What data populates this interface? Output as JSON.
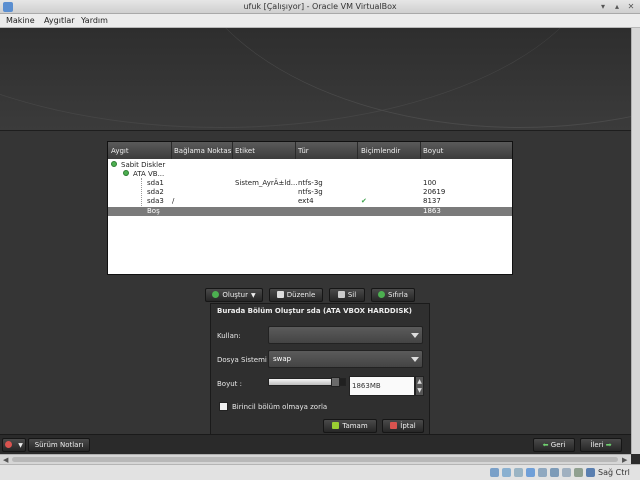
{
  "window": {
    "title": "ufuk [Çalışıyor] - Oracle VM VirtualBox"
  },
  "menu": {
    "items": [
      "Makine",
      "Aygıtlar",
      "Yardım"
    ]
  },
  "partition_table": {
    "columns": [
      "Aygıt",
      "Bağlama Noktası",
      "Etiket",
      "Tür",
      "Biçimlendir",
      "Boyut"
    ],
    "group_label": "Sabit Diskler",
    "disk_label": "ATA VB...",
    "rows": [
      {
        "device": "sda1",
        "mount": "",
        "label": "Sistem_AyrÄ±ld...",
        "type": "ntfs-3g",
        "format": "",
        "size": "100"
      },
      {
        "device": "sda2",
        "mount": "",
        "label": "",
        "type": "ntfs-3g",
        "format": "",
        "size": "20619"
      },
      {
        "device": "sda3",
        "mount": "/",
        "label": "",
        "type": "ext4",
        "format": "✔",
        "size": "8137"
      },
      {
        "device": "Boş",
        "mount": "",
        "label": "",
        "type": "",
        "format": "",
        "size": "1863"
      }
    ]
  },
  "actions": {
    "create": "Oluştur",
    "edit": "Düzenle",
    "delete": "Sil",
    "reset": "Sıfırla"
  },
  "dialog": {
    "title": "Burada Bölüm Oluştur sda (ATA VBOX HARDDISK)",
    "use_label": "Kullan:",
    "use_value": "",
    "fs_label": "Dosya Sistemi",
    "fs_value": "swap",
    "size_label": "Boyut :",
    "size_value": "1863MB",
    "size_fraction": 0.9,
    "primary_label": "Birincil bölüm olmaya zorla",
    "primary_checked": false,
    "ok_label": "Tamam",
    "cancel_label": "İptal"
  },
  "footer": {
    "release_notes": "Sürüm Notları",
    "back": "Geri",
    "next": "İleri"
  },
  "statusbar": {
    "host_key": "Sağ Ctrl"
  },
  "colors": {
    "accent_green": "#4caf50",
    "check_green": "#3fa34d",
    "delete_red": "#d9534f"
  }
}
